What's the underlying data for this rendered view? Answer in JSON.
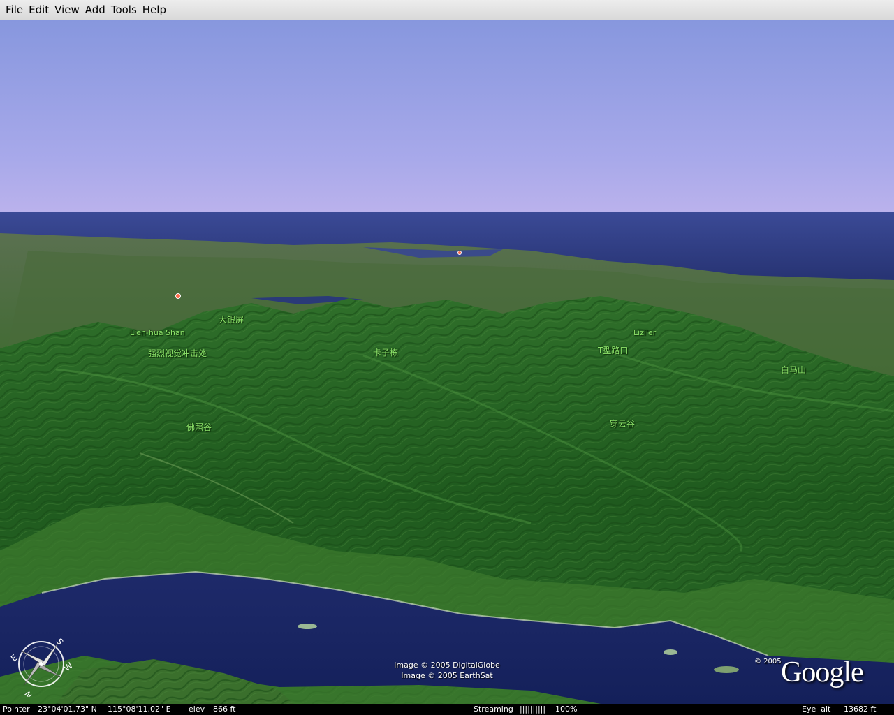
{
  "menu": {
    "items": [
      "File",
      "Edit",
      "View",
      "Add",
      "Tools",
      "Help"
    ]
  },
  "map": {
    "labels": {
      "da_yin_ping": "大银屏",
      "lien_hua_shan": "Lien-hua Shan",
      "qiang_lie": "强烈视觉冲击处",
      "ka_zi_hu": "卡子栋",
      "lizi_er": "Lizi'er",
      "t_xing_lu_kou": "T型路口",
      "bai_ma_shan": "白马山",
      "fo_zhao_gu": "佛照谷",
      "chuan_yun_gu": "穿云谷"
    },
    "credits": {
      "line1": "Image © 2005 DigitalGlobe",
      "line2": "Image © 2005 EarthSat"
    },
    "copyright": "© 2005",
    "logo": "Google",
    "compass_letters": {
      "north": "N",
      "south": "S",
      "east": "E",
      "west": "W"
    }
  },
  "status": {
    "pointer_label": "Pointer",
    "lat": "23°04'01.73\" N",
    "lon": "115°08'11.02\" E",
    "elev_label": "elev",
    "elev_value": "866 ft",
    "streaming_label": "Streaming",
    "streaming_bars": "||||||||||",
    "streaming_percent": "100%",
    "eye_alt_label": "Eye  alt",
    "eye_alt_value": "13682 ft"
  },
  "colors": {
    "sky_top": "#8a9be0",
    "sky_horizon": "#b7b2ec",
    "sea": "#2c3a86",
    "mountain": "#2d6a28",
    "label_green": "#8ee46a"
  }
}
